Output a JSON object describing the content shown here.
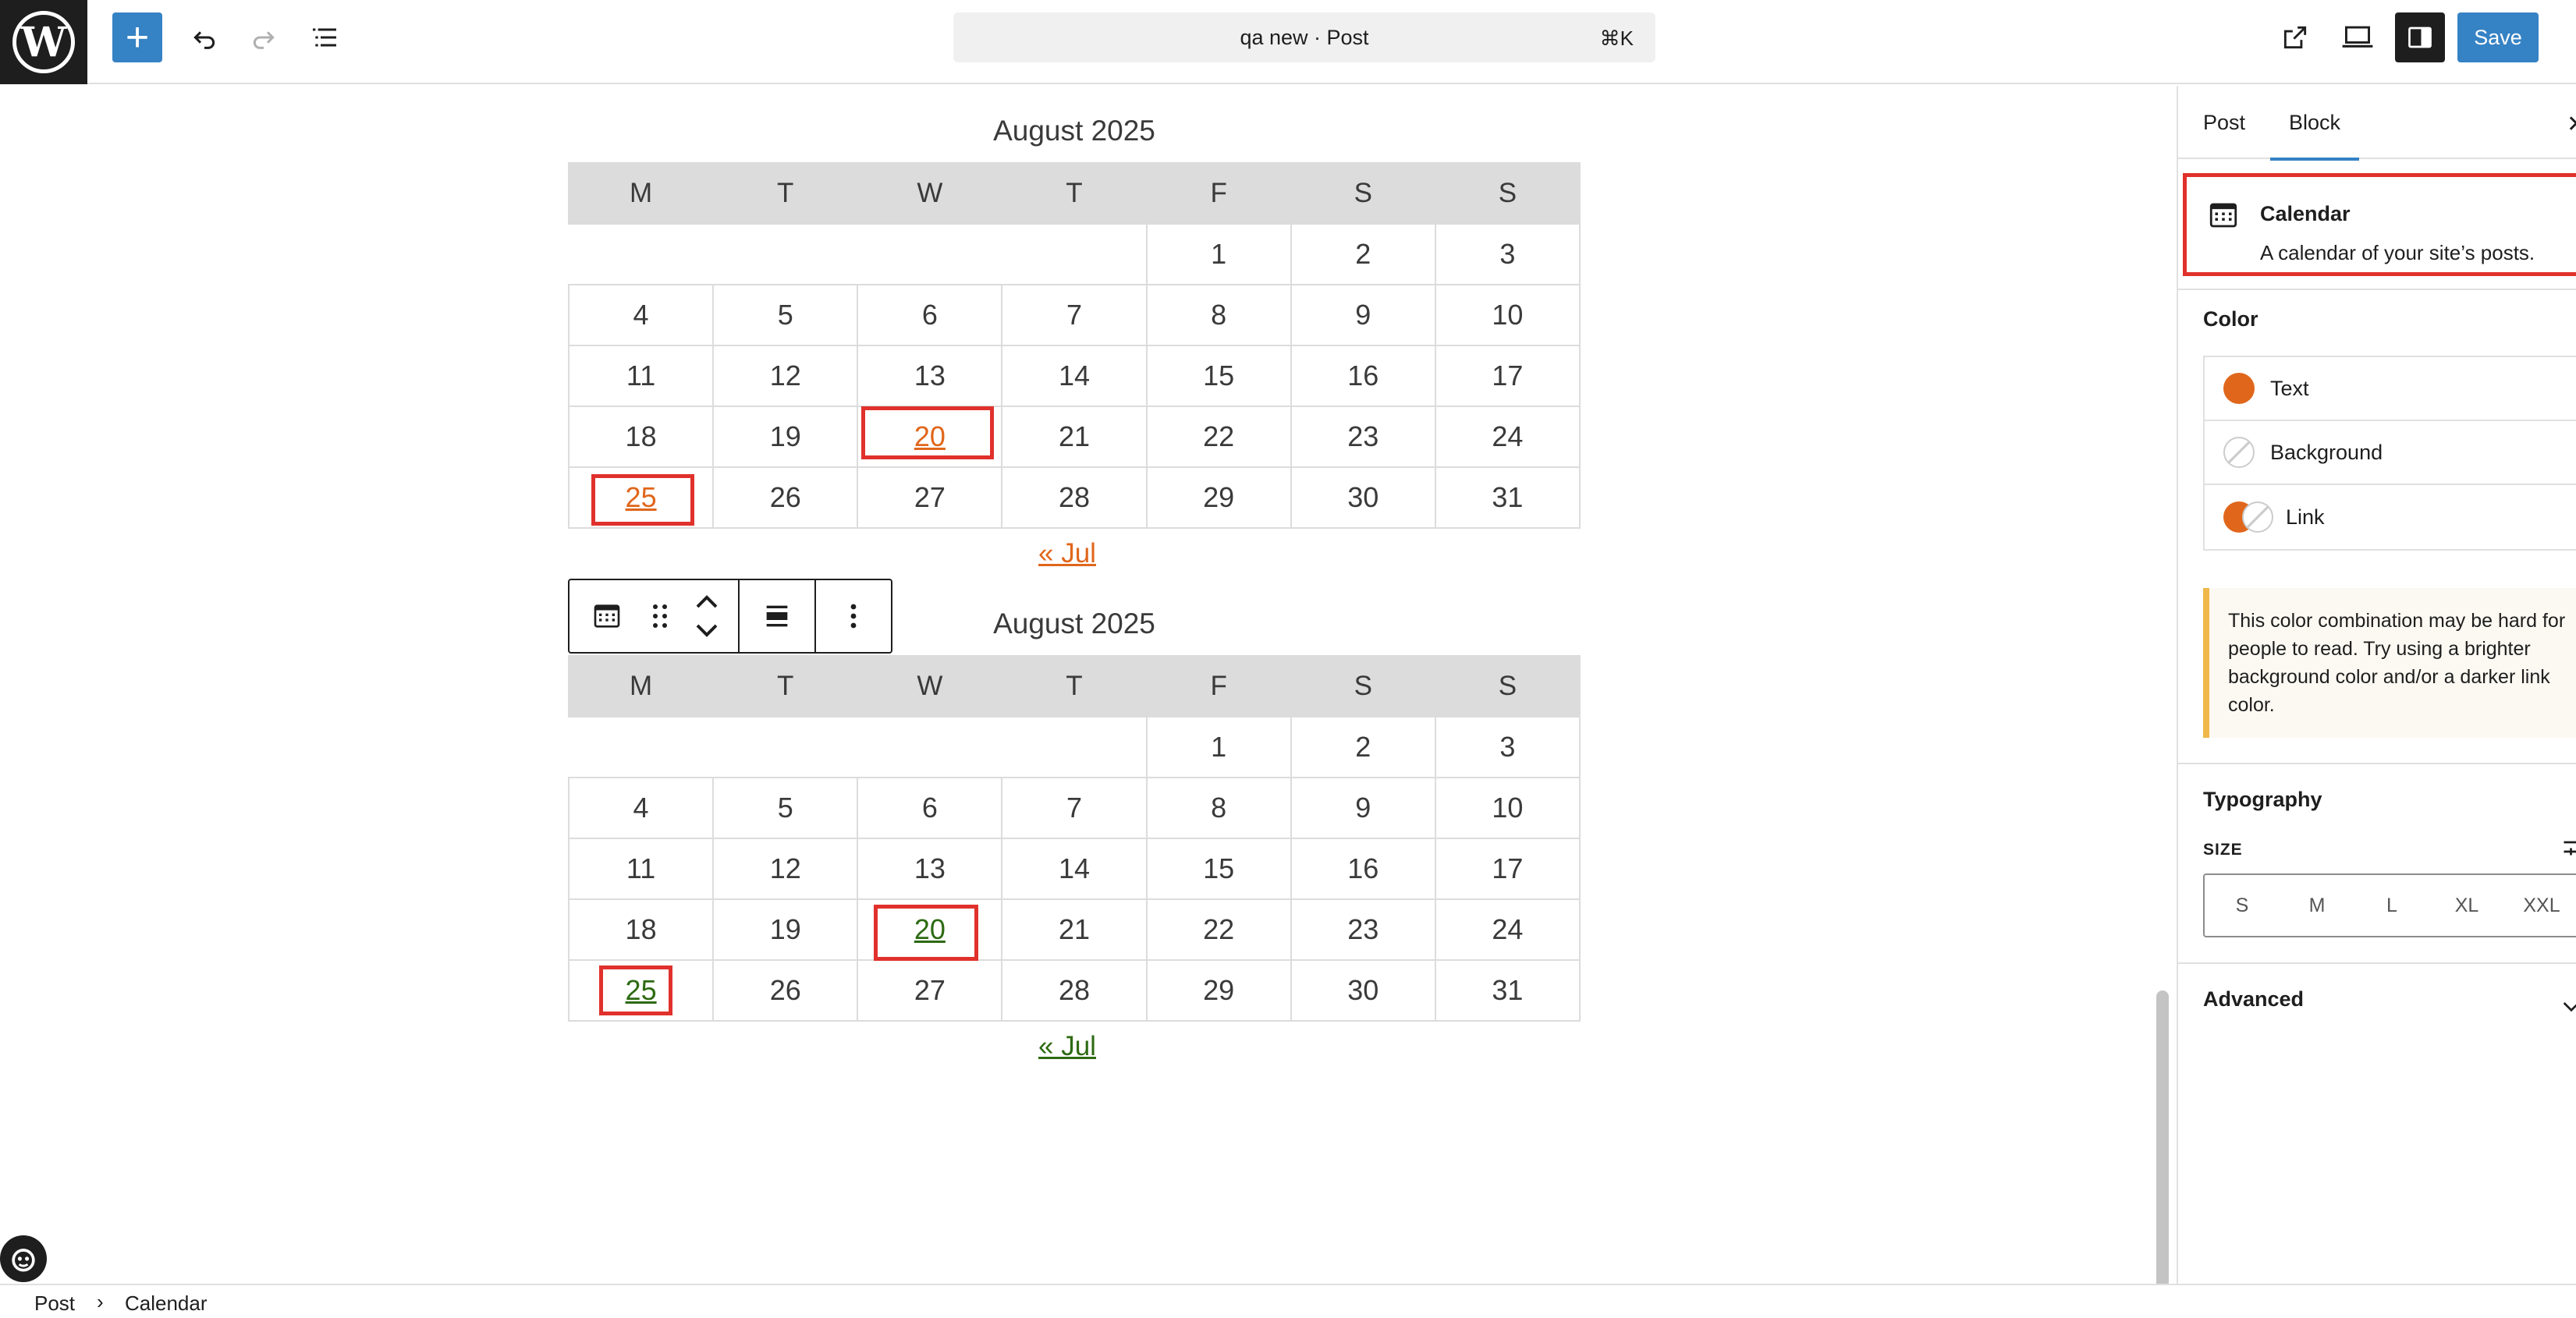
{
  "topbar": {
    "doc_title": "qa new · Post",
    "shortcut": "⌘K",
    "save_label": "Save"
  },
  "calendars": [
    {
      "caption": "August 2025",
      "weekdays": [
        "M",
        "T",
        "W",
        "T",
        "F",
        "S",
        "S"
      ],
      "days": [
        "1",
        "2",
        "3",
        "4",
        "5",
        "6",
        "7",
        "8",
        "9",
        "10",
        "11",
        "12",
        "13",
        "14",
        "15",
        "16",
        "17",
        "18",
        "19",
        "20",
        "21",
        "22",
        "23",
        "24",
        "25",
        "26",
        "27",
        "28",
        "29",
        "30",
        "31"
      ],
      "linked_days": [
        "20",
        "25"
      ],
      "prev_link": "« Jul",
      "link_color": "#e0661b"
    },
    {
      "caption": "August 2025",
      "weekdays": [
        "M",
        "T",
        "W",
        "T",
        "F",
        "S",
        "S"
      ],
      "days": [
        "1",
        "2",
        "3",
        "4",
        "5",
        "6",
        "7",
        "8",
        "9",
        "10",
        "11",
        "12",
        "13",
        "14",
        "15",
        "16",
        "17",
        "18",
        "19",
        "20",
        "21",
        "22",
        "23",
        "24",
        "25",
        "26",
        "27",
        "28",
        "29",
        "30",
        "31"
      ],
      "linked_days": [
        "20",
        "25"
      ],
      "prev_link": "« Jul",
      "link_color": "#2d6a12"
    }
  ],
  "sidebar": {
    "tabs": [
      "Post",
      "Block"
    ],
    "active_tab": "Block",
    "block": {
      "title": "Calendar",
      "description": "A calendar of your site’s posts."
    },
    "color_panel": {
      "title": "Color",
      "items": [
        "Text",
        "Background",
        "Link"
      ],
      "notice": "This color combination may be hard for people to read. Try using a brighter background color and/or a darker link color."
    },
    "typography_panel": {
      "title": "Typography",
      "size_label": "SIZE",
      "sizes": [
        "S",
        "M",
        "L",
        "XL",
        "XXL"
      ]
    },
    "advanced_panel": {
      "title": "Advanced"
    }
  },
  "breadcrumb": [
    "Post",
    "Calendar"
  ],
  "colors": {
    "accent": "#3582c4",
    "highlight": "#e0312c",
    "warning": "#f0b849"
  }
}
